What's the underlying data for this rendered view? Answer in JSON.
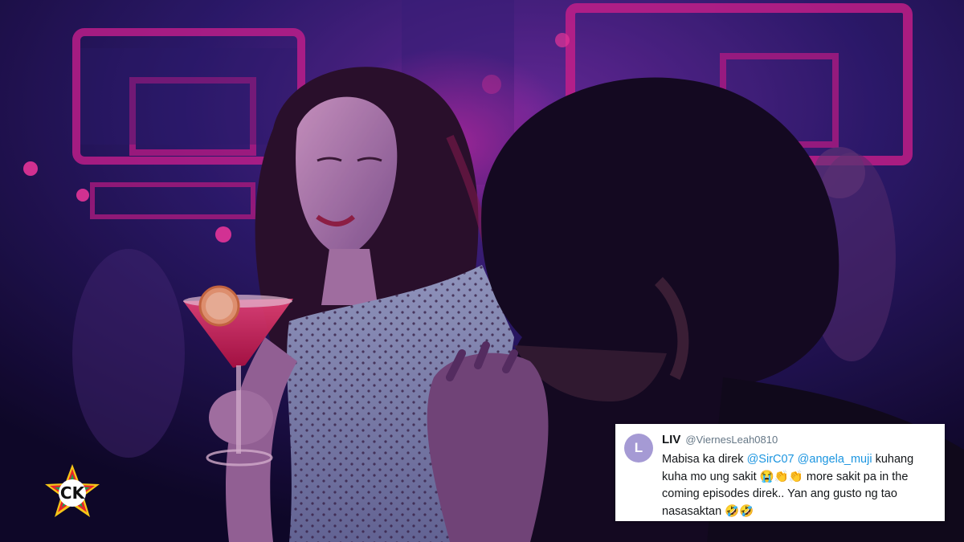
{
  "tweet": {
    "avatar_letter": "L",
    "display_name": "LIV",
    "handle": "@ViernesLeah0810",
    "text_1": "Mabisa ka direk ",
    "mention_1": "@SirC07",
    "text_2": " ",
    "mention_2": "@angela_muji",
    "text_3": " kuhang kuha mo ung sakit 😭👏👏 more sakit pa in the coming episodes direk.. Yan ang gusto ng tao nasasaktan 🤣🤣"
  },
  "logo": {
    "letters": "CK",
    "colors": [
      "#e8232a",
      "#1f9d55",
      "#f5c518",
      "#1b6fd1"
    ]
  },
  "colors": {
    "mention": "#1b95e0",
    "scene_magenta": "#d0208f",
    "scene_indigo": "#2a1a66"
  }
}
